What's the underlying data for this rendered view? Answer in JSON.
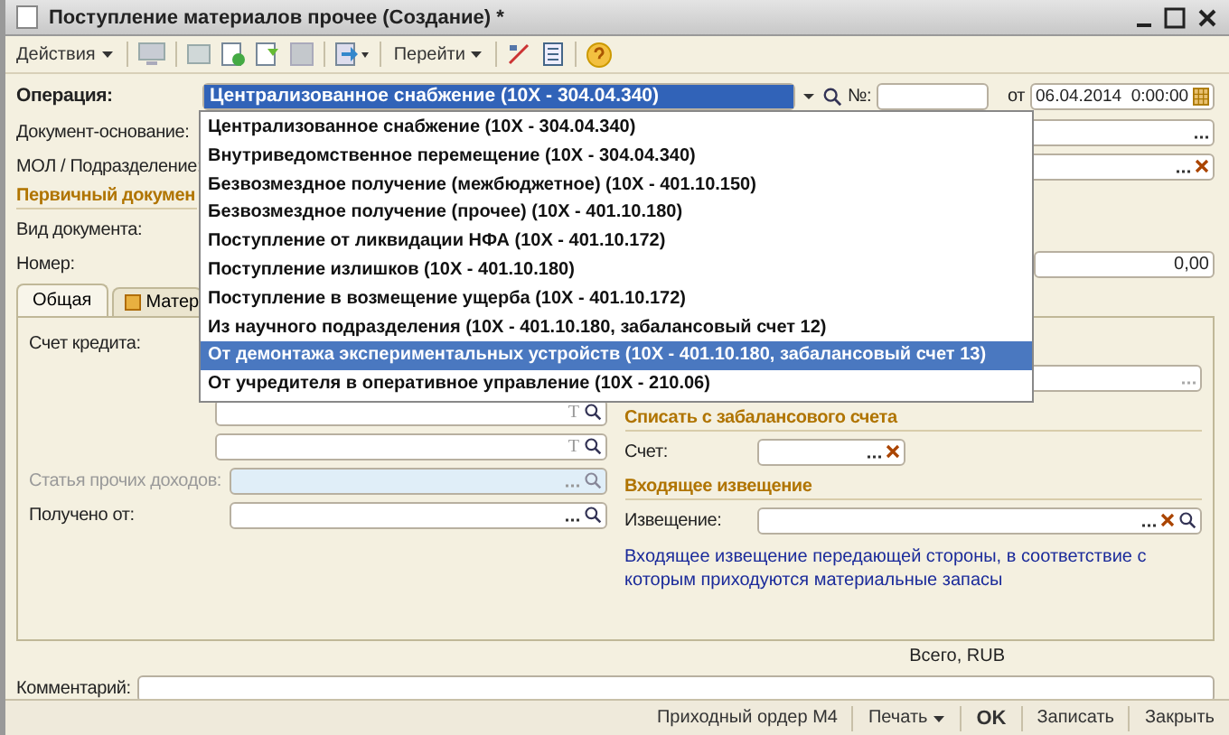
{
  "window": {
    "title": "Поступление материалов прочее (Создание) *"
  },
  "toolbar": {
    "actions": "Действия",
    "goto": "Перейти"
  },
  "operation": {
    "label": "Операция:",
    "value": "Централизованное снабжение (10X - 304.04.340)",
    "number_label": "№:",
    "date_label": "от",
    "date": "06.04.2014  0:00:00"
  },
  "header_fields": [
    {
      "label": "Документ-основание:",
      "clearable": false
    },
    {
      "label": "МОЛ / Подразделение:",
      "clearable": true
    }
  ],
  "primary_doc": {
    "title": "Первичный докумен",
    "type_label": "Вид документа:",
    "number_label": "Номер:",
    "amount": "0,00"
  },
  "tabs": [
    {
      "label": "Общая",
      "selected": true
    },
    {
      "label": "Матер",
      "selected": false
    }
  ],
  "left": {
    "credit_label": "Счет кредита:",
    "type_marks": [
      "T",
      "T"
    ],
    "income_label": "Статья прочих доходов:",
    "income_disabled": true,
    "received_label": "Получено от:"
  },
  "offbalance": {
    "title": "Списать с забалансового счета",
    "account_label": "Счет:"
  },
  "notice": {
    "title": "Входящее извещение",
    "label": "Извещение:",
    "note": "Входящее извещение передающей стороны, в соответствие с которым приходуются материальные запасы"
  },
  "total_label": "Всего, RUB",
  "comment": {
    "label": "Комментарий:"
  },
  "buttons": [
    {
      "label": "Приходный ордер М4",
      "kind": "plain"
    },
    {
      "label": "Печать",
      "kind": "menu"
    },
    {
      "label": "OK",
      "kind": "default"
    },
    {
      "label": "Записать",
      "kind": "plain"
    },
    {
      "label": "Закрыть",
      "kind": "plain"
    }
  ],
  "dropdown": {
    "items": [
      {
        "label": "Централизованное снабжение (10X - 304.04.340)",
        "selected": false
      },
      {
        "label": "Внутриведомственное перемещение (10X - 304.04.340)",
        "selected": false
      },
      {
        "label": "Безвозмездное получение (межбюджетное) (10X - 401.10.150)",
        "selected": false
      },
      {
        "label": "Безвозмездное получение (прочее) (10X - 401.10.180)",
        "selected": false
      },
      {
        "label": "Поступление от ликвидации НФА (10X - 401.10.172)",
        "selected": false
      },
      {
        "label": "Поступление излишков (10X - 401.10.180)",
        "selected": false
      },
      {
        "label": "Поступление в возмещение ущерба (10X - 401.10.172)",
        "selected": false
      },
      {
        "label": "Из научного подразделения (10X - 401.10.180, забалансовый счет 12)",
        "selected": false
      },
      {
        "label": "От демонтажа экспериментальных устройств (10X - 401.10.180, забалансовый счет 13)",
        "selected": true
      },
      {
        "label": "От учредителя в оперативное управление (10X - 210.06)",
        "selected": false
      }
    ]
  }
}
